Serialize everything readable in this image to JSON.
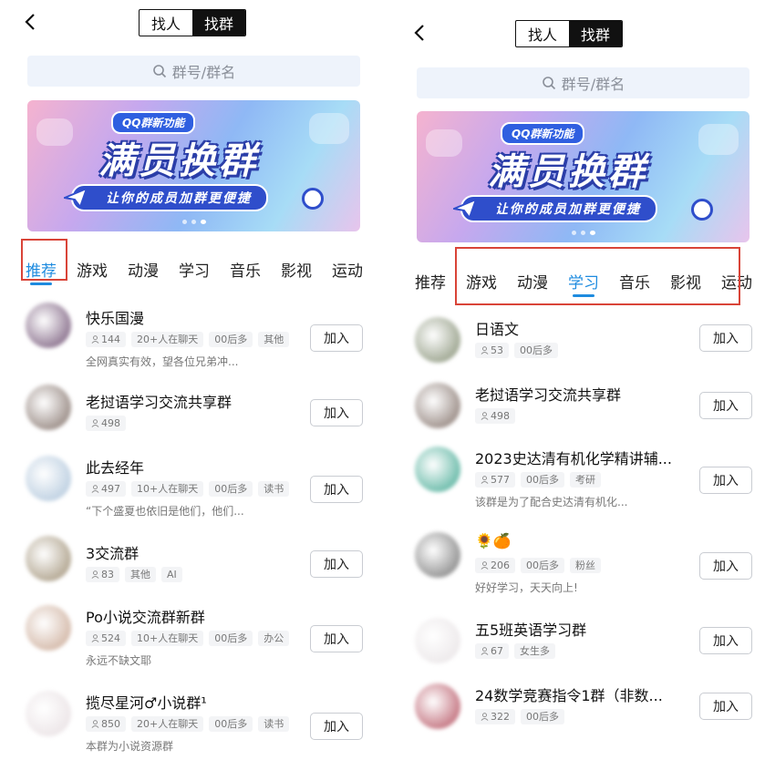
{
  "left": {
    "segment": {
      "find_people": "找人",
      "find_groups": "找群"
    },
    "search_placeholder": "群号/群名",
    "banner": {
      "tag": "QQ群新功能",
      "headline": "满员换群",
      "subline": "让你的成员加群更便捷"
    },
    "tabs": [
      "推荐",
      "游戏",
      "动漫",
      "学习",
      "音乐",
      "影视",
      "运动"
    ],
    "active_tab": 0,
    "groups": [
      {
        "name": "快乐国漫",
        "chips": [
          "144",
          "20+人在聊天",
          "00后多",
          "其他"
        ],
        "desc": "全网真实有效，望各位兄弟冲...",
        "join": "加入",
        "avatar_color": "#6a4a6e"
      },
      {
        "name": "老挝语学习交流共享群",
        "chips": [
          "498"
        ],
        "desc": "",
        "join": "加入",
        "avatar_color": "#7d6b63"
      },
      {
        "name": "此去经年",
        "chips": [
          "497",
          "10+人在聊天",
          "00后多",
          "读书"
        ],
        "desc": "“下个盛夏也依旧是他们，他们...",
        "join": "加入",
        "avatar_color": "#a9c1d8"
      },
      {
        "name": "3交流群",
        "chips": [
          "83",
          "其他",
          "AI"
        ],
        "desc": "",
        "join": "加入",
        "avatar_color": "#9a8a6e"
      },
      {
        "name": "Po小说交流群新群",
        "chips": [
          "524",
          "10+人在聊天",
          "00后多",
          "办公"
        ],
        "desc": "永远不缺文耶",
        "join": "加入",
        "avatar_color": "#c7a48f"
      },
      {
        "name": "揽尽星河♂小说群¹",
        "chips": [
          "850",
          "20+人在聊天",
          "00后多",
          "读书"
        ],
        "desc": "本群为小说资源群",
        "join": "加入",
        "avatar_color": "#e6dde0"
      }
    ]
  },
  "right": {
    "segment": {
      "find_people": "找人",
      "find_groups": "找群"
    },
    "search_placeholder": "群号/群名",
    "banner": {
      "tag": "QQ群新功能",
      "headline": "满员换群",
      "subline": "让你的成员加群更便捷"
    },
    "tabs": [
      "推荐",
      "游戏",
      "动漫",
      "学习",
      "音乐",
      "影视",
      "运动"
    ],
    "active_tab": 3,
    "groups": [
      {
        "name": "日语文",
        "chips": [
          "53",
          "00后多"
        ],
        "desc": "",
        "join": "加入",
        "avatar_color": "#7f8a6e"
      },
      {
        "name": "老挝语学习交流共享群",
        "chips": [
          "498"
        ],
        "desc": "",
        "join": "加入",
        "avatar_color": "#7d6b63"
      },
      {
        "name": "2023史达清有机化学精讲辅...",
        "chips": [
          "577",
          "00后多",
          "考研"
        ],
        "desc": "该群是为了配合史达清有机化...",
        "join": "加入",
        "avatar_color": "#3aa58e"
      },
      {
        "name": "🌻🍊",
        "chips": [
          "206",
          "00后多",
          "粉丝"
        ],
        "desc": "好好学习，天天向上!",
        "join": "加入",
        "avatar_color": "#6f6f6f"
      },
      {
        "name": "五5班英语学习群",
        "chips": [
          "67",
          "女生多"
        ],
        "desc": "",
        "join": "加入",
        "avatar_color": "#e7e2e4"
      },
      {
        "name": "24数学竞赛指令1群（非数...",
        "chips": [
          "322",
          "00后多"
        ],
        "desc": "",
        "join": "加入",
        "avatar_color": "#b24a5a"
      }
    ]
  }
}
